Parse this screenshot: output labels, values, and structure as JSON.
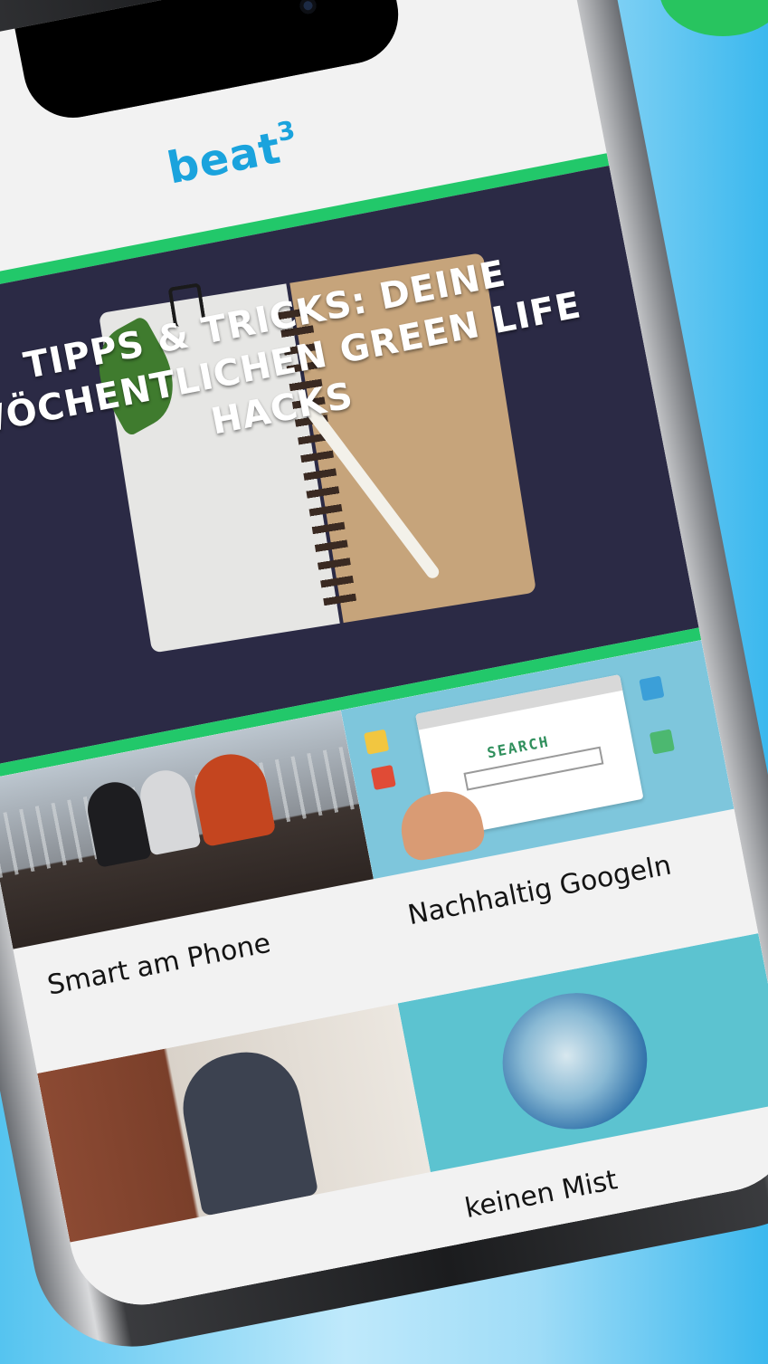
{
  "app": {
    "logo": "beat",
    "logo_superscript": "3"
  },
  "hero": {
    "title": "TIPPS & TRICKS: DEINE WÖCHENTLICHEN GREEN LIFE HACKS"
  },
  "articles": [
    {
      "label": "Smart am Phone"
    },
    {
      "label": "Nachhaltig Googeln"
    },
    {
      "label": ""
    },
    {
      "label": "keinen Mist"
    }
  ],
  "search_image": {
    "word": "SEARCH"
  },
  "colors": {
    "accent_green": "#22c86a",
    "logo_blue": "#1aa3dd",
    "hero_bg": "#2b2a45"
  }
}
